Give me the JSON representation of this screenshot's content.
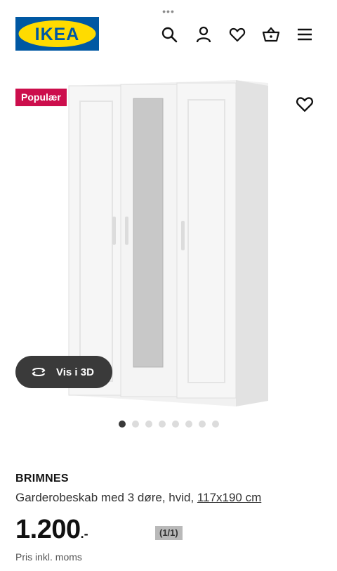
{
  "status_bar": {
    "dots": "•••"
  },
  "header": {
    "logo_text": "IKEA",
    "icons": [
      "search-icon",
      "user-icon",
      "heart-icon",
      "basket-icon",
      "menu-icon"
    ]
  },
  "hero": {
    "badge": "Populær",
    "view_3d_label": "Vis i 3D",
    "image_count": 8,
    "active_image": 1
  },
  "product": {
    "name": "BRIMNES",
    "description": "Garderobeskab med 3 døre, hvid,",
    "dimensions": "117x190 cm",
    "price": "1.200",
    "price_suffix": ".-",
    "vat_note": "Pris inkl. moms"
  },
  "overlay": {
    "counter": "(1/1)"
  },
  "colors": {
    "ikea_blue": "#0058a3",
    "ikea_yellow": "#ffdb00",
    "badge": "#cc0e4c",
    "pill": "#3a3a3a"
  }
}
